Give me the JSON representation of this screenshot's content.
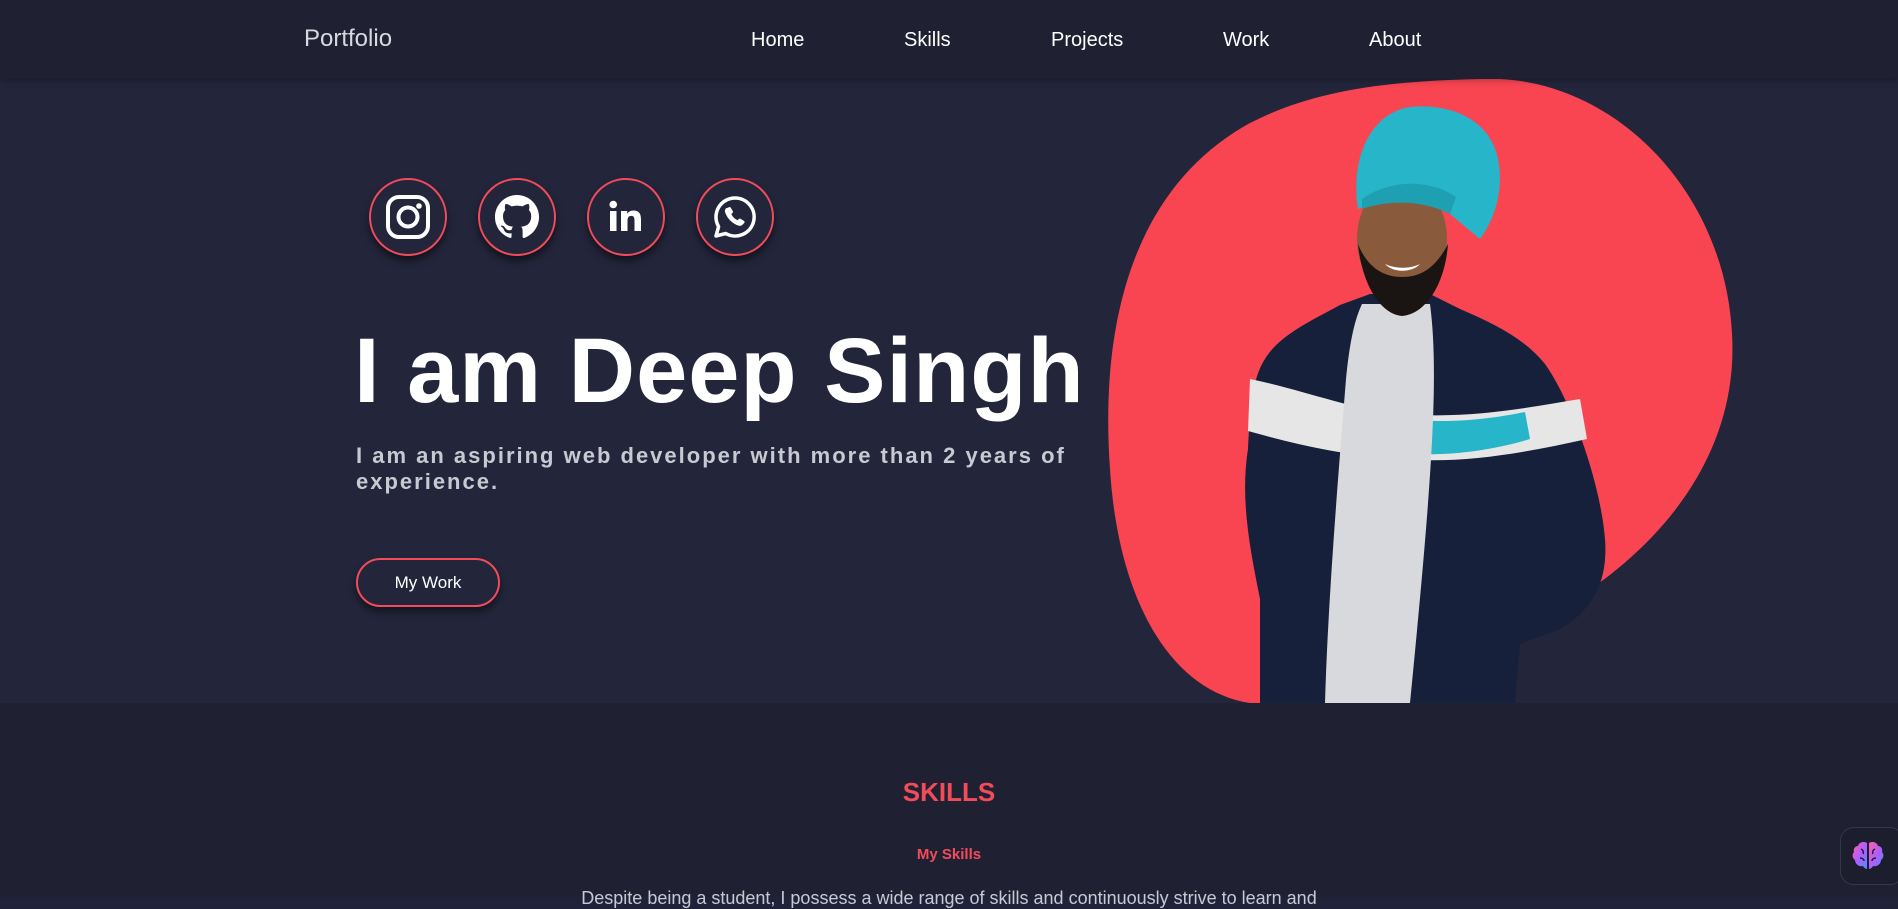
{
  "nav": {
    "brand": "Portfolio",
    "links": [
      "Home",
      "Skills",
      "Projects",
      "Work",
      "About"
    ]
  },
  "hero": {
    "social_icons": [
      "instagram-icon",
      "github-icon",
      "linkedin-icon",
      "whatsapp-icon"
    ],
    "title": "I am Deep Singh",
    "subtitle": "I am an aspiring web developer with more than 2 years of experience.",
    "cta_label": "My Work"
  },
  "skills": {
    "heading": "SKILLS",
    "subheading": "My Skills",
    "description": "Despite being a student, I possess a wide range of skills and continuously strive to learn and"
  },
  "colors": {
    "accent": "#f24b5a",
    "navbar_bg": "#1f2133",
    "hero_bg": "#23253b",
    "turban": "#27b5c9"
  },
  "widget": {
    "icon": "brain-icon"
  }
}
